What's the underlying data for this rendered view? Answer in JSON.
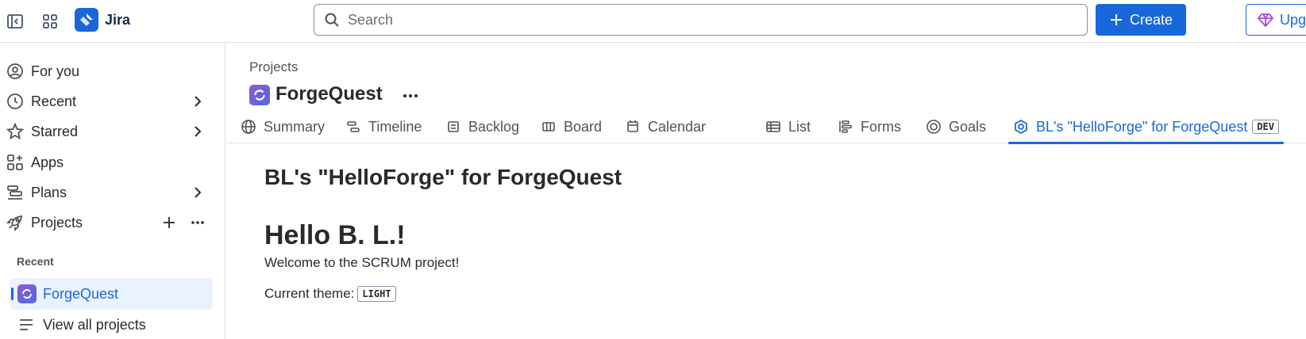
{
  "topbar": {
    "app_name": "Jira",
    "search_placeholder": "Search",
    "create_label": "Create",
    "upgrade_label": "Upgrade"
  },
  "sidebar": {
    "items": [
      {
        "label": "For you",
        "icon": "user-circle-icon",
        "has_chevron": false
      },
      {
        "label": "Recent",
        "icon": "clock-icon",
        "has_chevron": true
      },
      {
        "label": "Starred",
        "icon": "star-icon",
        "has_chevron": true
      },
      {
        "label": "Apps",
        "icon": "apps-icon",
        "has_chevron": false
      },
      {
        "label": "Plans",
        "icon": "plans-icon",
        "has_chevron": true
      },
      {
        "label": "Projects",
        "icon": "rocket-icon",
        "has_chevron": false
      }
    ],
    "recent_section_label": "Recent",
    "recent_project": "ForgeQuest",
    "view_all_label": "View all projects"
  },
  "header": {
    "breadcrumb": "Projects",
    "project_name": "ForgeQuest"
  },
  "tabs": [
    {
      "label": "Summary",
      "icon": "globe-icon"
    },
    {
      "label": "Timeline",
      "icon": "timeline-icon"
    },
    {
      "label": "Backlog",
      "icon": "backlog-icon"
    },
    {
      "label": "Board",
      "icon": "board-icon"
    },
    {
      "label": "Calendar",
      "icon": "calendar-icon"
    },
    {
      "label": "List",
      "icon": "list-icon"
    },
    {
      "label": "Forms",
      "icon": "forms-icon"
    },
    {
      "label": "Goals",
      "icon": "goals-icon"
    },
    {
      "label": "BL's \"HelloForge\" for ForgeQuest",
      "icon": "forge-app-icon",
      "active": true,
      "badge": "DEV"
    }
  ],
  "content": {
    "title": "BL's \"HelloForge\" for ForgeQuest",
    "greeting": "Hello B. L.!",
    "welcome": "Welcome to the SCRUM project!",
    "theme_label": "Current theme:",
    "theme_value": "LIGHT"
  },
  "colors": {
    "accent": "#1868db",
    "selected_bg": "#e9f2fe",
    "border": "#dcdfe4",
    "text": "#292a2e"
  }
}
